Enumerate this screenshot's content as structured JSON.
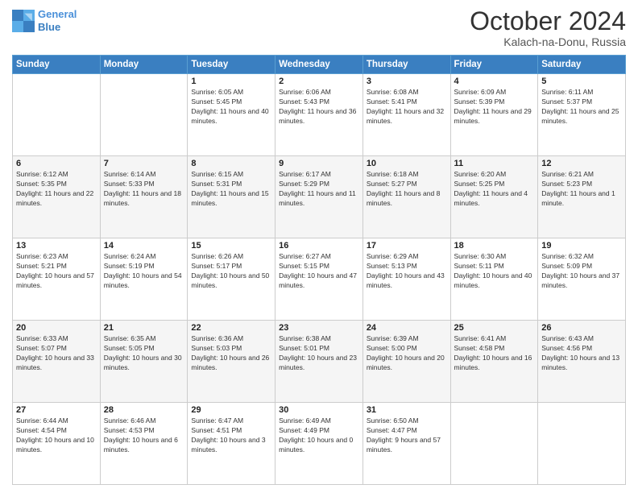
{
  "header": {
    "logo_line1": "General",
    "logo_line2": "Blue",
    "month_title": "October 2024",
    "location": "Kalach-na-Donu, Russia"
  },
  "days_of_week": [
    "Sunday",
    "Monday",
    "Tuesday",
    "Wednesday",
    "Thursday",
    "Friday",
    "Saturday"
  ],
  "weeks": [
    [
      {
        "num": "",
        "info": ""
      },
      {
        "num": "",
        "info": ""
      },
      {
        "num": "1",
        "info": "Sunrise: 6:05 AM\nSunset: 5:45 PM\nDaylight: 11 hours and 40 minutes."
      },
      {
        "num": "2",
        "info": "Sunrise: 6:06 AM\nSunset: 5:43 PM\nDaylight: 11 hours and 36 minutes."
      },
      {
        "num": "3",
        "info": "Sunrise: 6:08 AM\nSunset: 5:41 PM\nDaylight: 11 hours and 32 minutes."
      },
      {
        "num": "4",
        "info": "Sunrise: 6:09 AM\nSunset: 5:39 PM\nDaylight: 11 hours and 29 minutes."
      },
      {
        "num": "5",
        "info": "Sunrise: 6:11 AM\nSunset: 5:37 PM\nDaylight: 11 hours and 25 minutes."
      }
    ],
    [
      {
        "num": "6",
        "info": "Sunrise: 6:12 AM\nSunset: 5:35 PM\nDaylight: 11 hours and 22 minutes."
      },
      {
        "num": "7",
        "info": "Sunrise: 6:14 AM\nSunset: 5:33 PM\nDaylight: 11 hours and 18 minutes."
      },
      {
        "num": "8",
        "info": "Sunrise: 6:15 AM\nSunset: 5:31 PM\nDaylight: 11 hours and 15 minutes."
      },
      {
        "num": "9",
        "info": "Sunrise: 6:17 AM\nSunset: 5:29 PM\nDaylight: 11 hours and 11 minutes."
      },
      {
        "num": "10",
        "info": "Sunrise: 6:18 AM\nSunset: 5:27 PM\nDaylight: 11 hours and 8 minutes."
      },
      {
        "num": "11",
        "info": "Sunrise: 6:20 AM\nSunset: 5:25 PM\nDaylight: 11 hours and 4 minutes."
      },
      {
        "num": "12",
        "info": "Sunrise: 6:21 AM\nSunset: 5:23 PM\nDaylight: 11 hours and 1 minute."
      }
    ],
    [
      {
        "num": "13",
        "info": "Sunrise: 6:23 AM\nSunset: 5:21 PM\nDaylight: 10 hours and 57 minutes."
      },
      {
        "num": "14",
        "info": "Sunrise: 6:24 AM\nSunset: 5:19 PM\nDaylight: 10 hours and 54 minutes."
      },
      {
        "num": "15",
        "info": "Sunrise: 6:26 AM\nSunset: 5:17 PM\nDaylight: 10 hours and 50 minutes."
      },
      {
        "num": "16",
        "info": "Sunrise: 6:27 AM\nSunset: 5:15 PM\nDaylight: 10 hours and 47 minutes."
      },
      {
        "num": "17",
        "info": "Sunrise: 6:29 AM\nSunset: 5:13 PM\nDaylight: 10 hours and 43 minutes."
      },
      {
        "num": "18",
        "info": "Sunrise: 6:30 AM\nSunset: 5:11 PM\nDaylight: 10 hours and 40 minutes."
      },
      {
        "num": "19",
        "info": "Sunrise: 6:32 AM\nSunset: 5:09 PM\nDaylight: 10 hours and 37 minutes."
      }
    ],
    [
      {
        "num": "20",
        "info": "Sunrise: 6:33 AM\nSunset: 5:07 PM\nDaylight: 10 hours and 33 minutes."
      },
      {
        "num": "21",
        "info": "Sunrise: 6:35 AM\nSunset: 5:05 PM\nDaylight: 10 hours and 30 minutes."
      },
      {
        "num": "22",
        "info": "Sunrise: 6:36 AM\nSunset: 5:03 PM\nDaylight: 10 hours and 26 minutes."
      },
      {
        "num": "23",
        "info": "Sunrise: 6:38 AM\nSunset: 5:01 PM\nDaylight: 10 hours and 23 minutes."
      },
      {
        "num": "24",
        "info": "Sunrise: 6:39 AM\nSunset: 5:00 PM\nDaylight: 10 hours and 20 minutes."
      },
      {
        "num": "25",
        "info": "Sunrise: 6:41 AM\nSunset: 4:58 PM\nDaylight: 10 hours and 16 minutes."
      },
      {
        "num": "26",
        "info": "Sunrise: 6:43 AM\nSunset: 4:56 PM\nDaylight: 10 hours and 13 minutes."
      }
    ],
    [
      {
        "num": "27",
        "info": "Sunrise: 6:44 AM\nSunset: 4:54 PM\nDaylight: 10 hours and 10 minutes."
      },
      {
        "num": "28",
        "info": "Sunrise: 6:46 AM\nSunset: 4:53 PM\nDaylight: 10 hours and 6 minutes."
      },
      {
        "num": "29",
        "info": "Sunrise: 6:47 AM\nSunset: 4:51 PM\nDaylight: 10 hours and 3 minutes."
      },
      {
        "num": "30",
        "info": "Sunrise: 6:49 AM\nSunset: 4:49 PM\nDaylight: 10 hours and 0 minutes."
      },
      {
        "num": "31",
        "info": "Sunrise: 6:50 AM\nSunset: 4:47 PM\nDaylight: 9 hours and 57 minutes."
      },
      {
        "num": "",
        "info": ""
      },
      {
        "num": "",
        "info": ""
      }
    ]
  ]
}
